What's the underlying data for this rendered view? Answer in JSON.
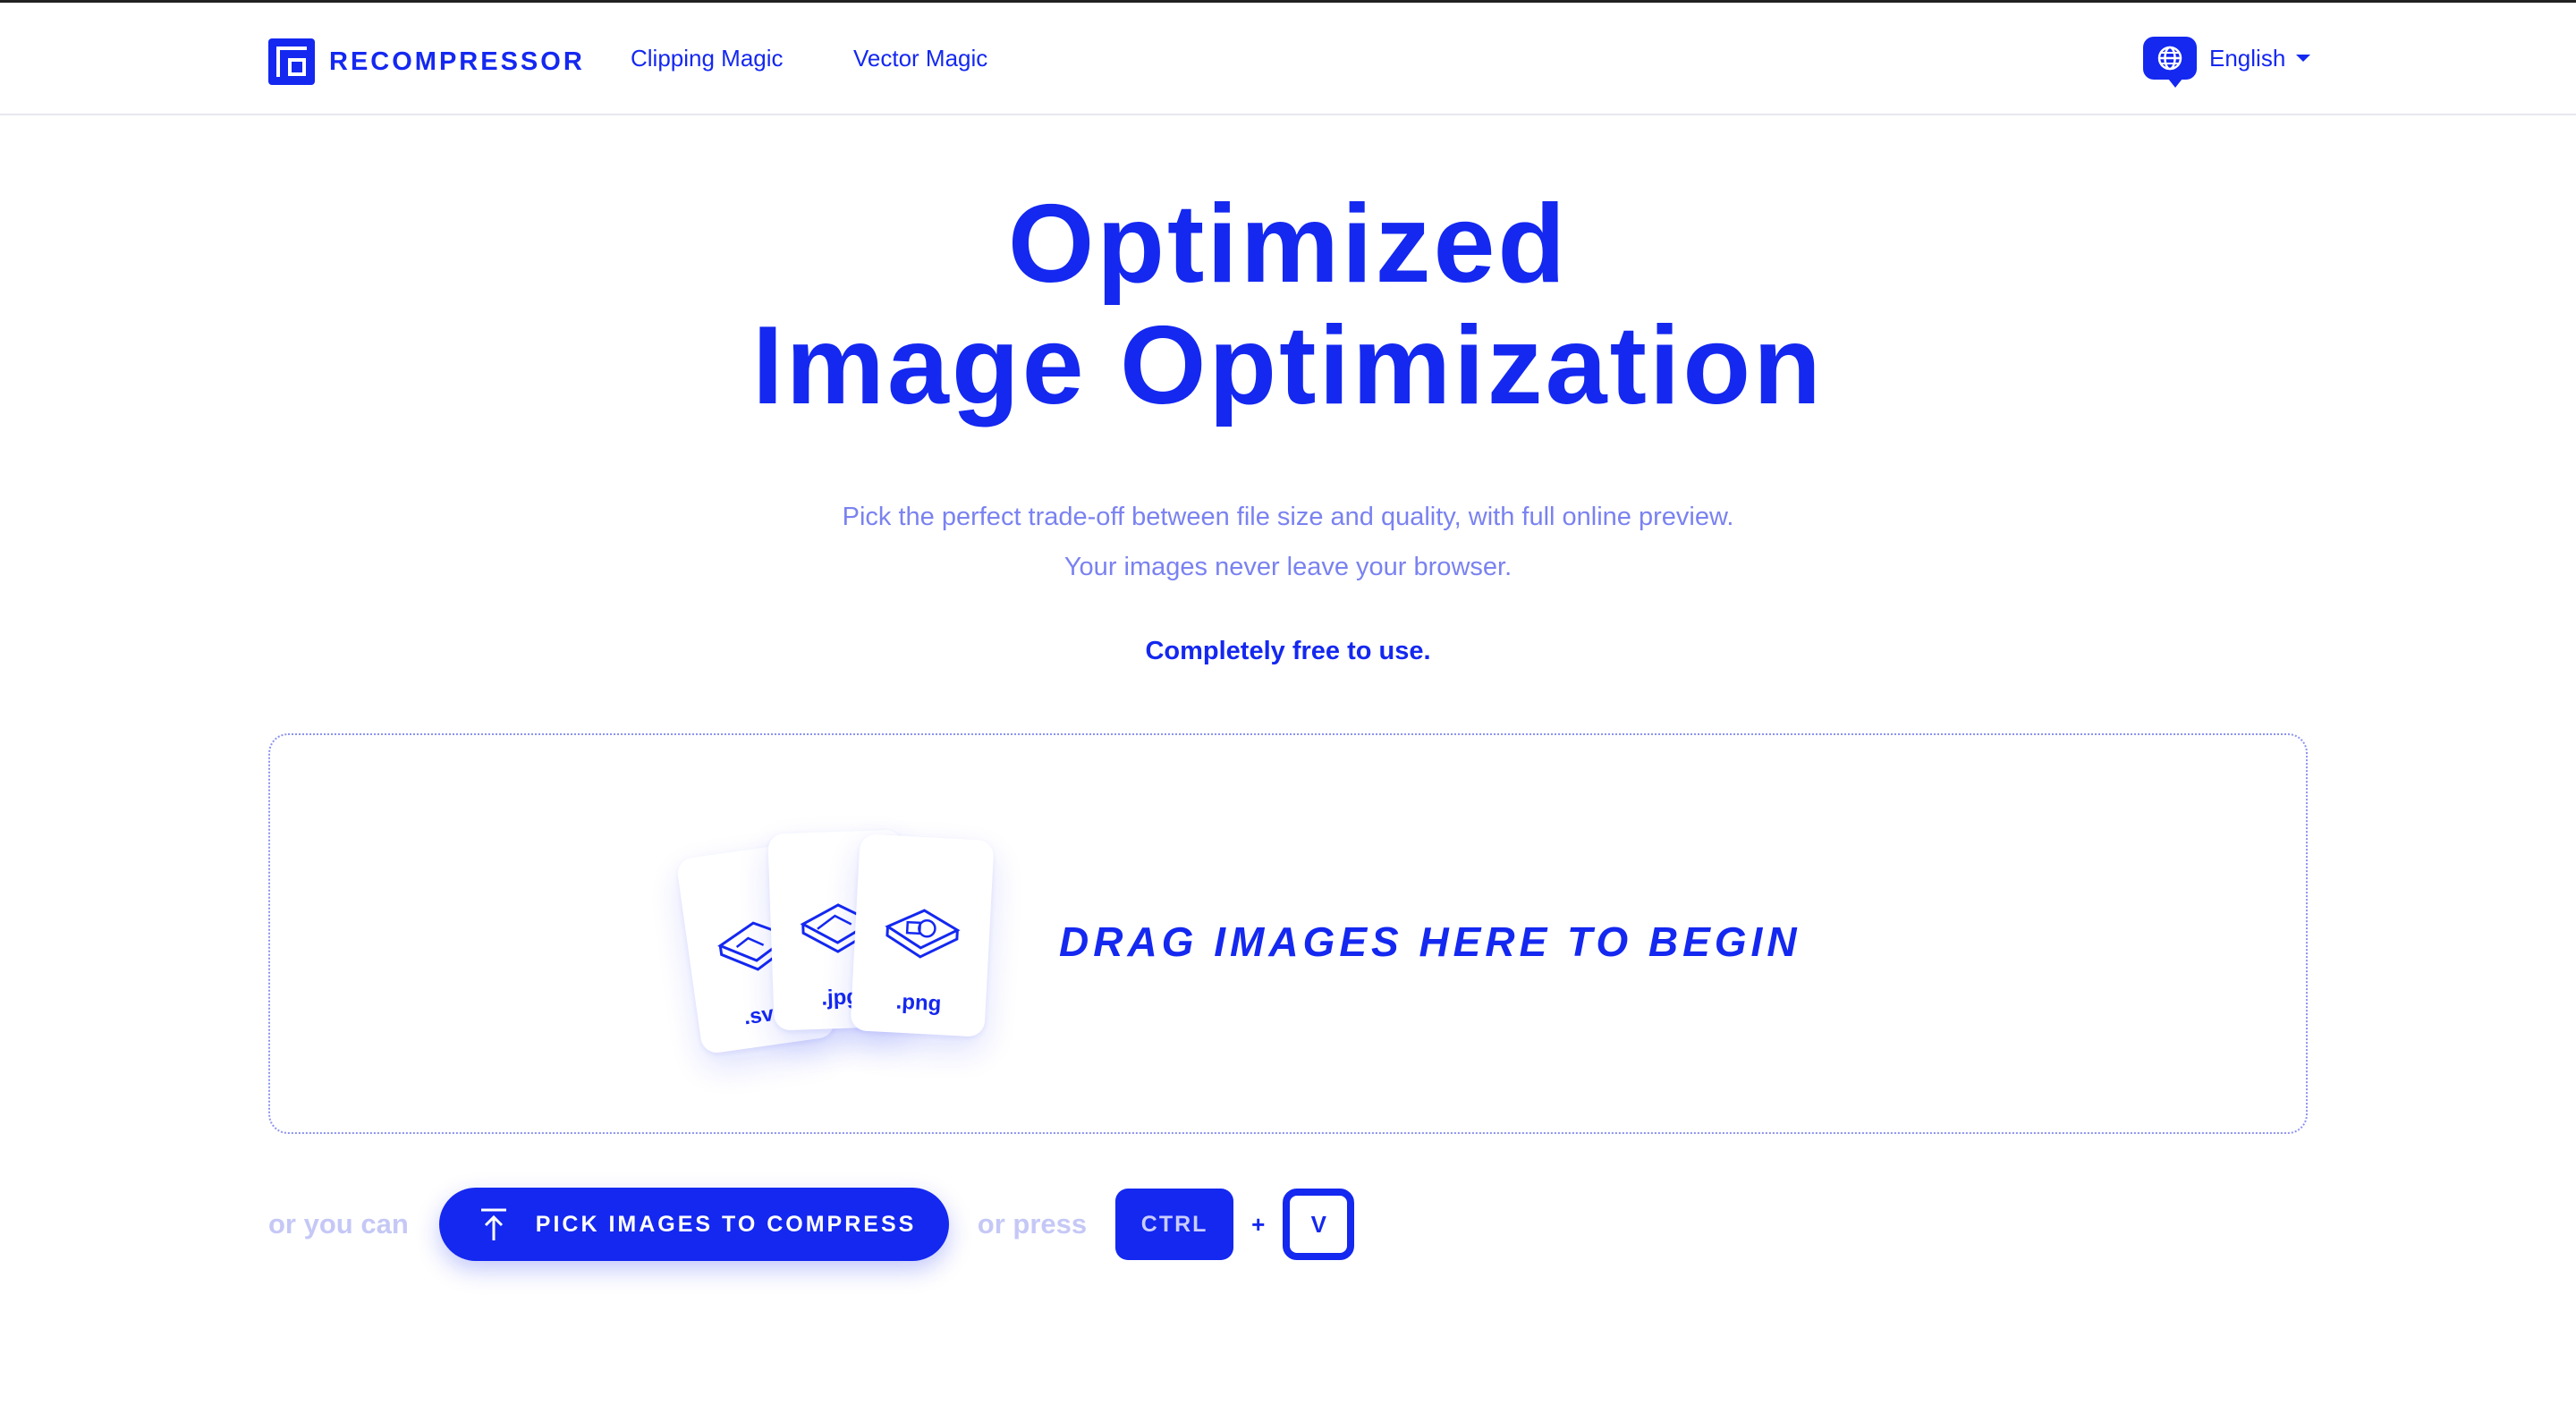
{
  "header": {
    "logo_text": "RECOMPRESSOR",
    "nav": [
      "Clipping Magic",
      "Vector Magic"
    ],
    "language": "English",
    "language_icon": "globe-icon"
  },
  "hero": {
    "title_line1": "Optimized",
    "title_line2": "Image Optimization",
    "sub_line1": "Pick the perfect trade-off between file size and quality, with full online preview.",
    "sub_line2": "Your images never leave your browser.",
    "free": "Completely free to use."
  },
  "dropzone": {
    "text": "DRAG IMAGES HERE TO BEGIN",
    "files": [
      ".svg",
      ".jpg",
      ".png"
    ]
  },
  "actions": {
    "or_you_can": "or you can",
    "pick_button": "PICK IMAGES TO COMPRESS",
    "pick_icon": "upload-icon",
    "or_press": "or press",
    "key1": "CTRL",
    "plus": "+",
    "key2": "V"
  },
  "colors": {
    "brand": "#1428f0",
    "muted": "#7a82f0",
    "muted_light": "#c5c8f6"
  }
}
